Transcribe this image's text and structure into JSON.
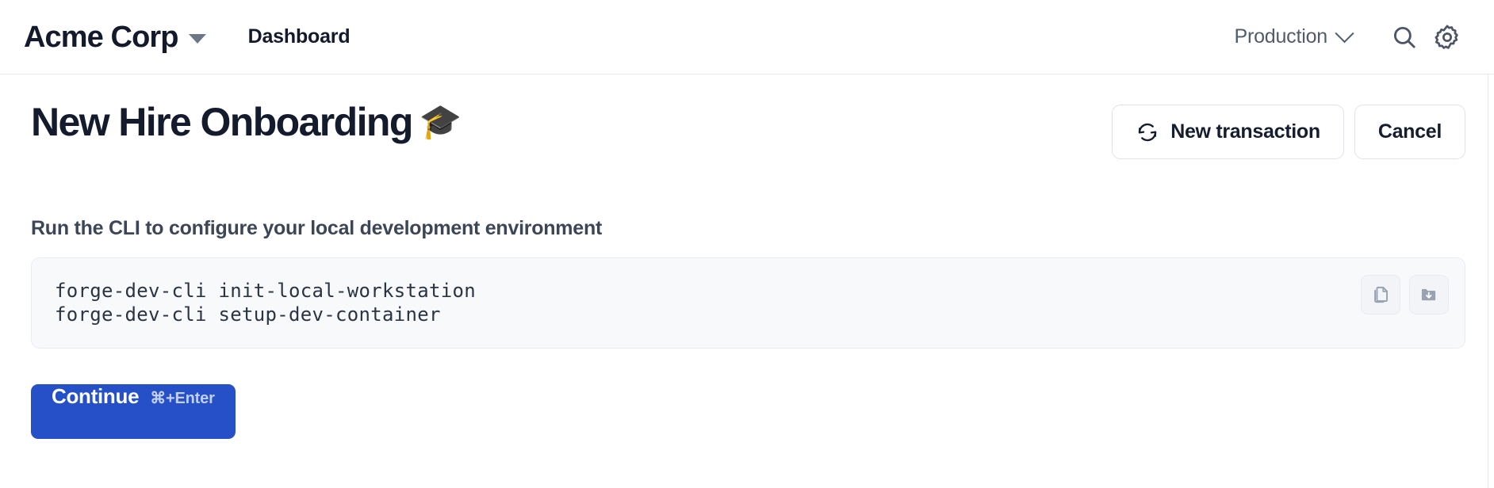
{
  "topbar": {
    "brand": "Acme Corp",
    "brand_caret_icon": "caret-down-icon",
    "nav_link": "Dashboard",
    "environment": "Production",
    "environment_chevron_icon": "chevron-down-icon",
    "search_icon": "search-icon",
    "settings_icon": "gear-icon"
  },
  "page": {
    "title": "New Hire Onboarding",
    "title_emoji": "🎓",
    "actions": [
      {
        "label": "New transaction",
        "icon": "refresh-icon",
        "style": "outline"
      },
      {
        "label": "Cancel",
        "icon": "",
        "style": "outline"
      }
    ],
    "section_label": "Run the CLI to configure your local development environment",
    "code": {
      "lines": [
        "forge-dev-cli init-local-workstation",
        "forge-dev-cli setup-dev-container"
      ],
      "tools": [
        {
          "name": "copy-icon",
          "title": "Copy"
        },
        {
          "name": "folder-download-icon",
          "title": "Download"
        }
      ]
    },
    "primary_action": {
      "label": "Continue",
      "shortcut": "⌘+Enter"
    }
  },
  "colors": {
    "accent": "#2550c8",
    "text": "#141b2d",
    "muted": "#515b6b",
    "border": "#e6e8eb",
    "code_bg": "#f8f9fb"
  }
}
